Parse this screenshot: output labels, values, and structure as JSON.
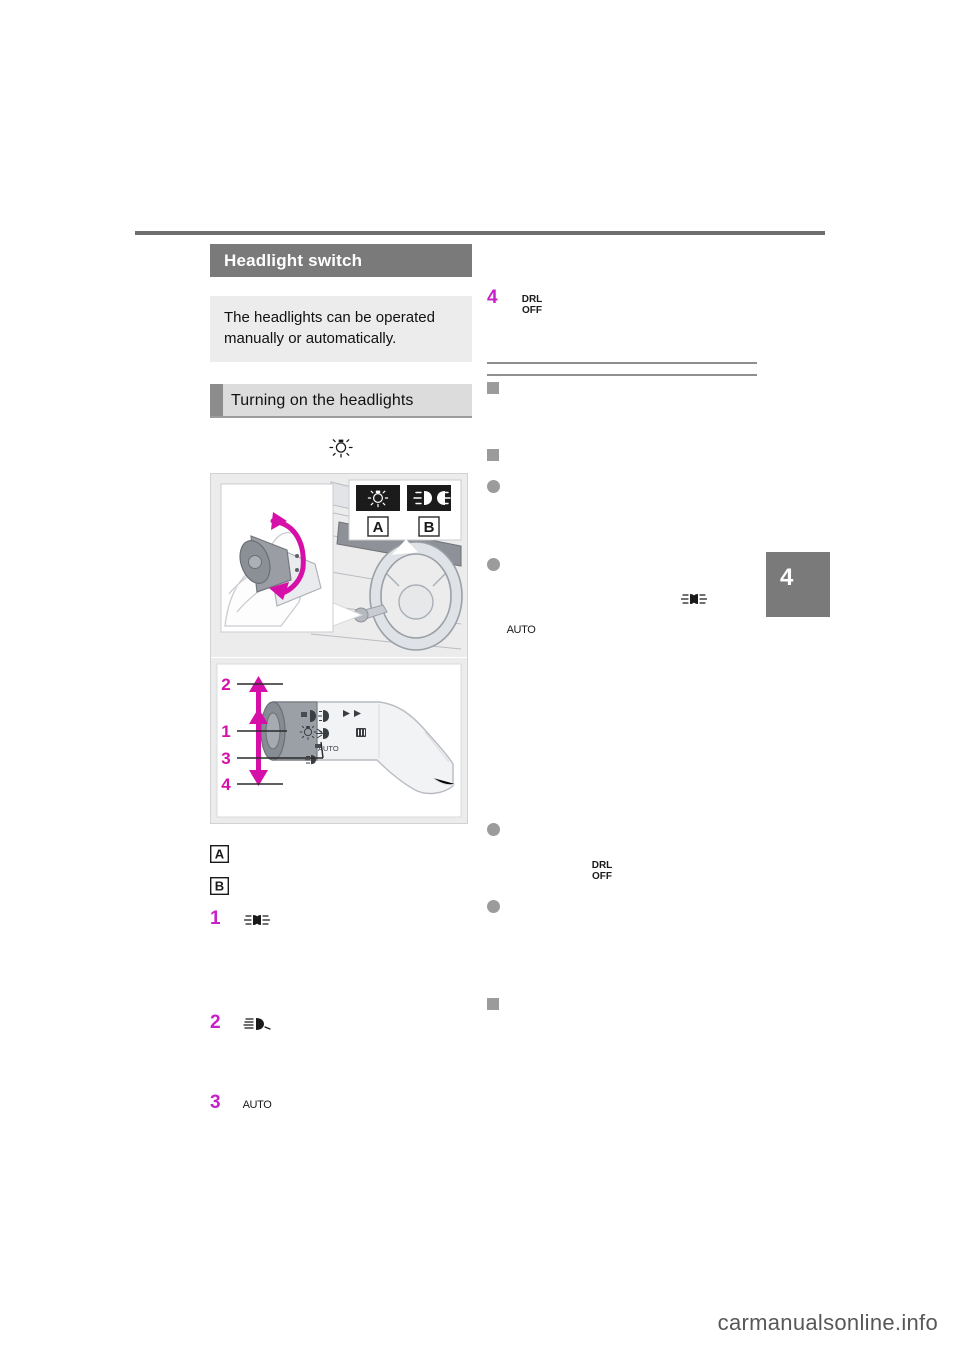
{
  "page": {
    "chapter_tab": "4",
    "watermark": "carmanualsonline.info"
  },
  "left_column": {
    "section_title": "Headlight switch",
    "lead_text": "The headlights can be operated manually or automatically.",
    "subsection_title": "Turning on the headlights",
    "bulb_icon": "headlight-bulb-icon",
    "figure_top": {
      "legend_a_label": "A",
      "legend_b_label": "B",
      "legend_a_icon": "parking-light-bulb-icon",
      "legend_b_icon": "low-beam-headlight-icon"
    },
    "figure_bottom": {
      "callouts": [
        "2",
        "1",
        "3",
        "4"
      ],
      "stalk_symbols": [
        "front-fog-icon",
        "low-beam-icon",
        "turn-signal-icon",
        "bulb-icon",
        "rear-fog-icon",
        "AUTO",
        "parking-light-icon",
        "rear-wiper-icon"
      ]
    },
    "items": [
      {
        "marker": "A",
        "marker_kind": "box",
        "icon": "",
        "text": ""
      },
      {
        "marker": "B",
        "marker_kind": "box",
        "icon": "",
        "text": ""
      },
      {
        "marker": "1",
        "marker_kind": "number",
        "icon": "parking-tail-light-icon",
        "text": ""
      },
      {
        "marker": "2",
        "marker_kind": "number",
        "icon": "low-beam-headlight-icon",
        "text": ""
      },
      {
        "marker": "3",
        "marker_kind": "number",
        "icon": "auto-mode-icon",
        "text": ""
      }
    ]
  },
  "right_column": {
    "items": [
      {
        "marker": "4",
        "marker_kind": "number",
        "icon": "drl-off-icon",
        "text": ""
      }
    ],
    "subsection_title": "",
    "bullets": [
      {
        "kind": "square",
        "icon": "",
        "text": ""
      },
      {
        "kind": "round",
        "icon": "",
        "text": ""
      },
      {
        "kind": "round",
        "icon": "",
        "text": "",
        "inline_icons": [
          "low-beam-headlight-icon",
          "auto-mode-icon"
        ]
      },
      {
        "kind": "round",
        "icon": "",
        "text": "",
        "inline_icons": [
          "drl-off-icon"
        ]
      },
      {
        "kind": "round",
        "icon": "",
        "text": ""
      },
      {
        "kind": "square",
        "icon": "",
        "text": ""
      }
    ]
  },
  "icons": {
    "drl_off_line1": "DRL",
    "drl_off_line2": "OFF",
    "auto_label": "AUTO"
  },
  "colors": {
    "accent_magenta": "#c820c8",
    "header_grey": "#7a7a7a",
    "panel_grey": "#ececec",
    "subhead_grey": "#dcdcdc",
    "bullet_grey": "#9b9b9b"
  }
}
